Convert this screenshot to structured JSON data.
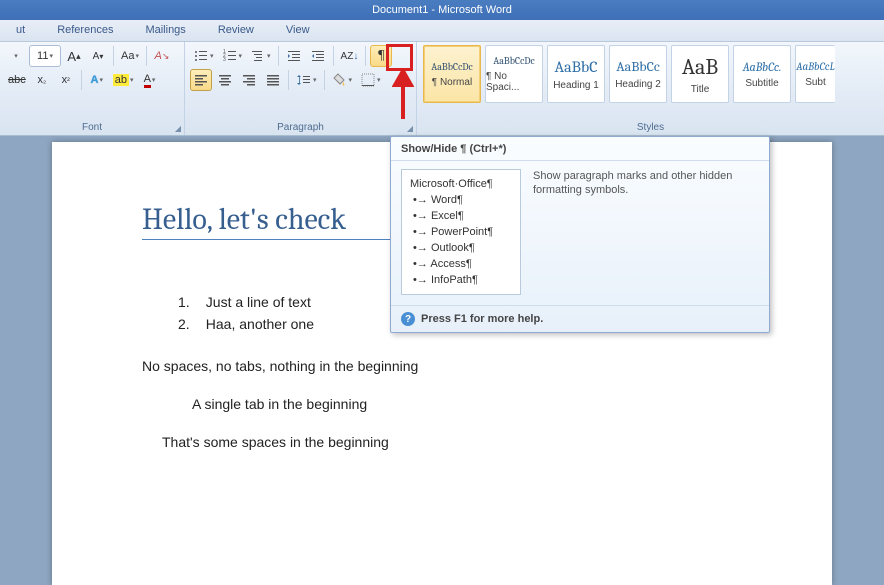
{
  "titlebar": "Document1 - Microsoft Word",
  "tabs": [
    "ut",
    "References",
    "Mailings",
    "Review",
    "View"
  ],
  "font": {
    "size": "11",
    "group_label": "Font"
  },
  "paragraph": {
    "group_label": "Paragraph"
  },
  "styles": {
    "group_label": "Styles",
    "items": [
      {
        "preview": "AaBbCcDc",
        "label": "¶ Normal",
        "psize": "12px",
        "color": "#333"
      },
      {
        "preview": "AaBbCcDc",
        "label": "¶ No Spaci...",
        "psize": "12px",
        "color": "#333"
      },
      {
        "preview": "AaBbC",
        "label": "Heading 1",
        "psize": "16px",
        "color": "#2f6fa7"
      },
      {
        "preview": "AaBbCc",
        "label": "Heading 2",
        "psize": "14px",
        "color": "#2f6fa7"
      },
      {
        "preview": "AaB",
        "label": "Title",
        "psize": "22px",
        "color": "#333"
      },
      {
        "preview": "AaBbCc.",
        "label": "Subtitle",
        "psize": "12px",
        "color": "#2f6fa7",
        "italic": true
      },
      {
        "preview": "AaBbCcL",
        "label": "Subt",
        "psize": "11px",
        "color": "#2f6fa7",
        "italic": true
      }
    ]
  },
  "supertip": {
    "title": "Show/Hide ¶ (Ctrl+*)",
    "preview_header": "Microsoft·Office¶",
    "preview_items": [
      "Word¶",
      "Excel¶",
      "PowerPoint¶",
      "Outlook¶",
      "Access¶",
      "InfoPath¶"
    ],
    "desc": "Show paragraph marks and other hidden formatting symbols.",
    "help": "Press F1 for more help."
  },
  "document": {
    "heading": "Hello, let's check",
    "list": [
      "Just a line of text",
      "Haa, another one"
    ],
    "p1": "No spaces, no tabs, nothing in the beginning",
    "p2": "A single tab in the beginning",
    "p3": "That's some spaces in the beginning"
  }
}
